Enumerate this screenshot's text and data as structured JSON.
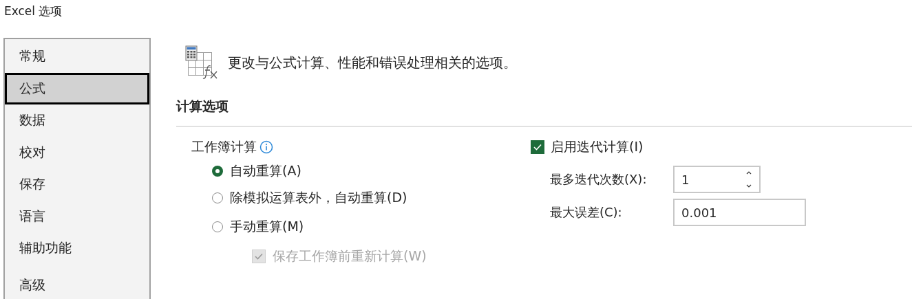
{
  "window": {
    "title": "Excel 选项"
  },
  "sidebar": {
    "items": [
      {
        "label": "常规",
        "selected": false
      },
      {
        "label": "公式",
        "selected": true
      },
      {
        "label": "数据",
        "selected": false
      },
      {
        "label": "校对",
        "selected": false
      },
      {
        "label": "保存",
        "selected": false
      },
      {
        "label": "语言",
        "selected": false
      },
      {
        "label": "辅助功能",
        "selected": false
      },
      {
        "label": "高级",
        "selected": false
      }
    ]
  },
  "header": {
    "text": "更改与公式计算、性能和错误处理相关的选项。"
  },
  "section": {
    "title": "计算选项",
    "workbook_calculation": {
      "label": "工作簿计算",
      "options": [
        {
          "label": "自动重算(A)",
          "selected": true
        },
        {
          "label": "除模拟运算表外，自动重算(D)",
          "selected": false
        },
        {
          "label": "手动重算(M)",
          "selected": false
        }
      ],
      "recalc_before_save": {
        "label": "保存工作簿前重新计算(W)",
        "checked": true,
        "disabled": true
      }
    },
    "iterative": {
      "label": "启用迭代计算(I)",
      "checked": true,
      "disabled": false,
      "max_iterations": {
        "label": "最多迭代次数(X):",
        "value": "1"
      },
      "max_change": {
        "label": "最大误差(C):",
        "value": "0.001"
      }
    }
  }
}
